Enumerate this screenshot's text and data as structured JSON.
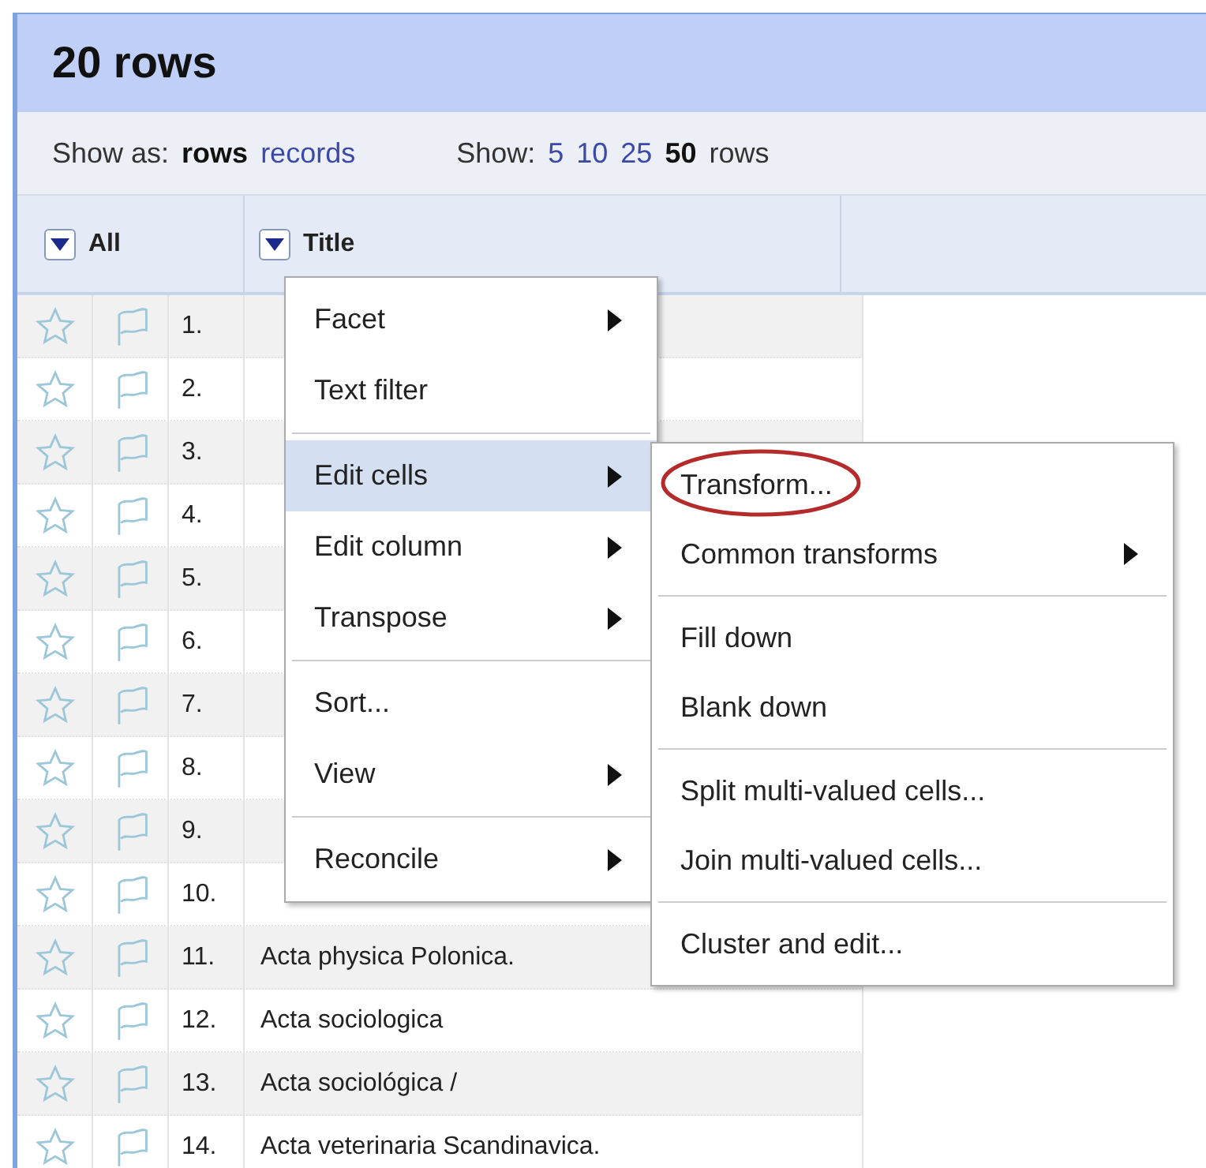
{
  "header": {
    "title": "20 rows"
  },
  "toolbar": {
    "show_as_label": "Show as:",
    "modes": [
      {
        "label": "rows",
        "selected": true
      },
      {
        "label": "records",
        "selected": false
      }
    ],
    "show_label": "Show:",
    "page_sizes": [
      {
        "label": "5",
        "selected": false
      },
      {
        "label": "10",
        "selected": false
      },
      {
        "label": "25",
        "selected": false
      },
      {
        "label": "50",
        "selected": true
      }
    ],
    "unit": "rows"
  },
  "columns": [
    {
      "label": "All"
    },
    {
      "label": "Title"
    }
  ],
  "rows": [
    {
      "number": "1.",
      "starred": false,
      "flagged": false
    },
    {
      "number": "2.",
      "starred": false,
      "flagged": false
    },
    {
      "number": "3.",
      "starred": false,
      "flagged": false
    },
    {
      "number": "4.",
      "starred": false,
      "flagged": false
    },
    {
      "number": "5.",
      "starred": false,
      "flagged": false
    },
    {
      "number": "6.",
      "starred": false,
      "flagged": false
    },
    {
      "number": "7.",
      "starred": false,
      "flagged": false
    },
    {
      "number": "8.",
      "starred": false,
      "flagged": false
    },
    {
      "number": "9.",
      "starred": false,
      "flagged": false
    },
    {
      "number": "10.",
      "starred": false,
      "flagged": false
    },
    {
      "number": "11.",
      "title": "Acta physica Polonica.",
      "starred": false,
      "flagged": false
    },
    {
      "number": "12.",
      "title": "Acta sociologica",
      "starred": false,
      "flagged": false
    },
    {
      "number": "13.",
      "title": "Acta sociológica /",
      "starred": false,
      "flagged": false
    },
    {
      "number": "14.",
      "title": "Acta veterinaria Scandinavica.",
      "starred": false,
      "flagged": false
    }
  ],
  "column_menu": {
    "groups": [
      [
        {
          "label": "Facet",
          "submenu": true,
          "selected": false
        },
        {
          "label": "Text filter",
          "submenu": false,
          "selected": false
        }
      ],
      [
        {
          "label": "Edit cells",
          "submenu": true,
          "selected": true
        },
        {
          "label": "Edit column",
          "submenu": true,
          "selected": false
        },
        {
          "label": "Transpose",
          "submenu": true,
          "selected": false
        }
      ],
      [
        {
          "label": "Sort...",
          "submenu": false,
          "selected": false
        },
        {
          "label": "View",
          "submenu": true,
          "selected": false
        }
      ],
      [
        {
          "label": "Reconcile",
          "submenu": true,
          "selected": false
        }
      ]
    ]
  },
  "edit_cells_menu": {
    "groups": [
      [
        {
          "label": "Transform...",
          "submenu": false,
          "circled": true
        },
        {
          "label": "Common transforms",
          "submenu": true,
          "circled": false
        }
      ],
      [
        {
          "label": "Fill down",
          "submenu": false,
          "circled": false
        },
        {
          "label": "Blank down",
          "submenu": false,
          "circled": false
        }
      ],
      [
        {
          "label": "Split multi-valued cells...",
          "submenu": false,
          "circled": false
        },
        {
          "label": "Join multi-valued cells...",
          "submenu": false,
          "circled": false
        }
      ],
      [
        {
          "label": "Cluster and edit...",
          "submenu": false,
          "circled": false
        }
      ]
    ]
  }
}
